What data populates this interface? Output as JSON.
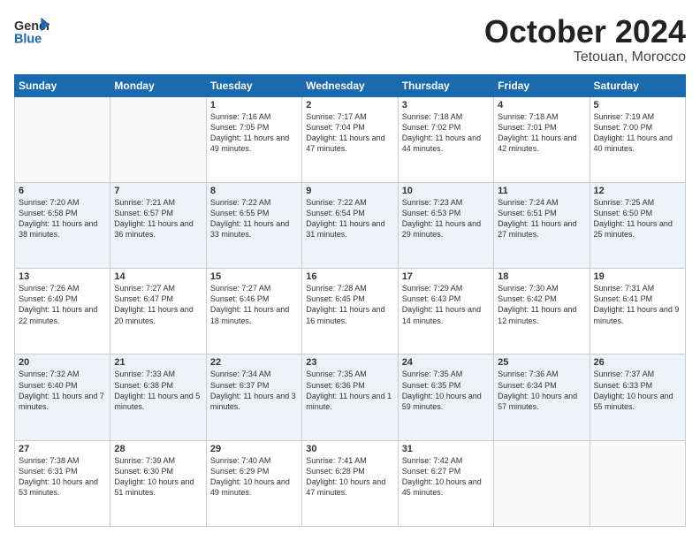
{
  "header": {
    "logo_general": "General",
    "logo_blue": "Blue",
    "month_title": "October 2024",
    "subtitle": "Tetouan, Morocco"
  },
  "weekdays": [
    "Sunday",
    "Monday",
    "Tuesday",
    "Wednesday",
    "Thursday",
    "Friday",
    "Saturday"
  ],
  "weeks": [
    [
      {
        "day": "",
        "info": ""
      },
      {
        "day": "",
        "info": ""
      },
      {
        "day": "1",
        "info": "Sunrise: 7:16 AM\nSunset: 7:05 PM\nDaylight: 11 hours and 49 minutes."
      },
      {
        "day": "2",
        "info": "Sunrise: 7:17 AM\nSunset: 7:04 PM\nDaylight: 11 hours and 47 minutes."
      },
      {
        "day": "3",
        "info": "Sunrise: 7:18 AM\nSunset: 7:02 PM\nDaylight: 11 hours and 44 minutes."
      },
      {
        "day": "4",
        "info": "Sunrise: 7:18 AM\nSunset: 7:01 PM\nDaylight: 11 hours and 42 minutes."
      },
      {
        "day": "5",
        "info": "Sunrise: 7:19 AM\nSunset: 7:00 PM\nDaylight: 11 hours and 40 minutes."
      }
    ],
    [
      {
        "day": "6",
        "info": "Sunrise: 7:20 AM\nSunset: 6:58 PM\nDaylight: 11 hours and 38 minutes."
      },
      {
        "day": "7",
        "info": "Sunrise: 7:21 AM\nSunset: 6:57 PM\nDaylight: 11 hours and 36 minutes."
      },
      {
        "day": "8",
        "info": "Sunrise: 7:22 AM\nSunset: 6:55 PM\nDaylight: 11 hours and 33 minutes."
      },
      {
        "day": "9",
        "info": "Sunrise: 7:22 AM\nSunset: 6:54 PM\nDaylight: 11 hours and 31 minutes."
      },
      {
        "day": "10",
        "info": "Sunrise: 7:23 AM\nSunset: 6:53 PM\nDaylight: 11 hours and 29 minutes."
      },
      {
        "day": "11",
        "info": "Sunrise: 7:24 AM\nSunset: 6:51 PM\nDaylight: 11 hours and 27 minutes."
      },
      {
        "day": "12",
        "info": "Sunrise: 7:25 AM\nSunset: 6:50 PM\nDaylight: 11 hours and 25 minutes."
      }
    ],
    [
      {
        "day": "13",
        "info": "Sunrise: 7:26 AM\nSunset: 6:49 PM\nDaylight: 11 hours and 22 minutes."
      },
      {
        "day": "14",
        "info": "Sunrise: 7:27 AM\nSunset: 6:47 PM\nDaylight: 11 hours and 20 minutes."
      },
      {
        "day": "15",
        "info": "Sunrise: 7:27 AM\nSunset: 6:46 PM\nDaylight: 11 hours and 18 minutes."
      },
      {
        "day": "16",
        "info": "Sunrise: 7:28 AM\nSunset: 6:45 PM\nDaylight: 11 hours and 16 minutes."
      },
      {
        "day": "17",
        "info": "Sunrise: 7:29 AM\nSunset: 6:43 PM\nDaylight: 11 hours and 14 minutes."
      },
      {
        "day": "18",
        "info": "Sunrise: 7:30 AM\nSunset: 6:42 PM\nDaylight: 11 hours and 12 minutes."
      },
      {
        "day": "19",
        "info": "Sunrise: 7:31 AM\nSunset: 6:41 PM\nDaylight: 11 hours and 9 minutes."
      }
    ],
    [
      {
        "day": "20",
        "info": "Sunrise: 7:32 AM\nSunset: 6:40 PM\nDaylight: 11 hours and 7 minutes."
      },
      {
        "day": "21",
        "info": "Sunrise: 7:33 AM\nSunset: 6:38 PM\nDaylight: 11 hours and 5 minutes."
      },
      {
        "day": "22",
        "info": "Sunrise: 7:34 AM\nSunset: 6:37 PM\nDaylight: 11 hours and 3 minutes."
      },
      {
        "day": "23",
        "info": "Sunrise: 7:35 AM\nSunset: 6:36 PM\nDaylight: 11 hours and 1 minute."
      },
      {
        "day": "24",
        "info": "Sunrise: 7:35 AM\nSunset: 6:35 PM\nDaylight: 10 hours and 59 minutes."
      },
      {
        "day": "25",
        "info": "Sunrise: 7:36 AM\nSunset: 6:34 PM\nDaylight: 10 hours and 57 minutes."
      },
      {
        "day": "26",
        "info": "Sunrise: 7:37 AM\nSunset: 6:33 PM\nDaylight: 10 hours and 55 minutes."
      }
    ],
    [
      {
        "day": "27",
        "info": "Sunrise: 7:38 AM\nSunset: 6:31 PM\nDaylight: 10 hours and 53 minutes."
      },
      {
        "day": "28",
        "info": "Sunrise: 7:39 AM\nSunset: 6:30 PM\nDaylight: 10 hours and 51 minutes."
      },
      {
        "day": "29",
        "info": "Sunrise: 7:40 AM\nSunset: 6:29 PM\nDaylight: 10 hours and 49 minutes."
      },
      {
        "day": "30",
        "info": "Sunrise: 7:41 AM\nSunset: 6:28 PM\nDaylight: 10 hours and 47 minutes."
      },
      {
        "day": "31",
        "info": "Sunrise: 7:42 AM\nSunset: 6:27 PM\nDaylight: 10 hours and 45 minutes."
      },
      {
        "day": "",
        "info": ""
      },
      {
        "day": "",
        "info": ""
      }
    ]
  ]
}
